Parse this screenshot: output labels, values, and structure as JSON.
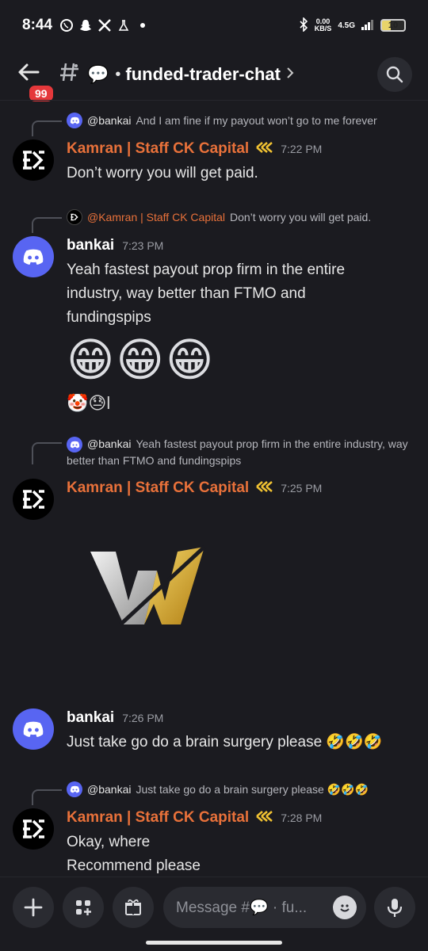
{
  "status": {
    "time": "8:44",
    "net_speed": "0.00\nKB/S",
    "net_type": "4.5G",
    "battery": "10"
  },
  "header": {
    "badge": "99",
    "channel": "funded-trader-chat"
  },
  "messages": [
    {
      "reply_user": "@bankai",
      "reply_text": "And I am fine if my payout won’t go to me forever",
      "author": "Kamran | Staff CK Capital",
      "time": "7:22 PM",
      "lines": [
        "Don’t worry you will get paid."
      ]
    },
    {
      "reply_user": "@Kamran | Staff CK Capital",
      "reply_text": "Don’t worry you will get paid.",
      "author": "bankai",
      "time": "7:23 PM",
      "lines": [
        "Yeah fastest payout prop firm in the entire",
        "industry, way better than FTMO and",
        "fundingspips"
      ],
      "big_emojis": [
        "😁",
        "😁",
        "😁"
      ],
      "reactions": "🤡😓l"
    },
    {
      "reply_user": "@bankai",
      "reply_text": "Yeah fastest payout prop firm in the entire industry, way better than FTMO and fundingspips",
      "author": "Kamran | Staff CK Capital",
      "time": "7:25 PM"
    },
    {
      "author": "bankai",
      "time": "7:26 PM",
      "lines": [
        "Just take go do a brain surgery please 🤣🤣🤣"
      ]
    },
    {
      "reply_user": "@bankai",
      "reply_text": "Just take go do a brain surgery please 🤣🤣🤣",
      "author": "Kamran | Staff CK Capital",
      "time": "7:28 PM",
      "lines": [
        "Okay, where",
        "Recommend please"
      ]
    }
  ],
  "composer": {
    "placeholder": "Message #💬 · fu..."
  },
  "colors": {
    "background": "#1b1b20",
    "staff_name": "#e8713a",
    "discord_blurple": "#5865f2"
  },
  "icons": {
    "back": "arrow-left-icon",
    "channel": "threads-hash-icon",
    "search": "search-icon",
    "add": "plus-icon",
    "apps": "apps-icon",
    "gift": "gift-icon",
    "emoji": "emoji-icon",
    "mic": "microphone-icon"
  }
}
